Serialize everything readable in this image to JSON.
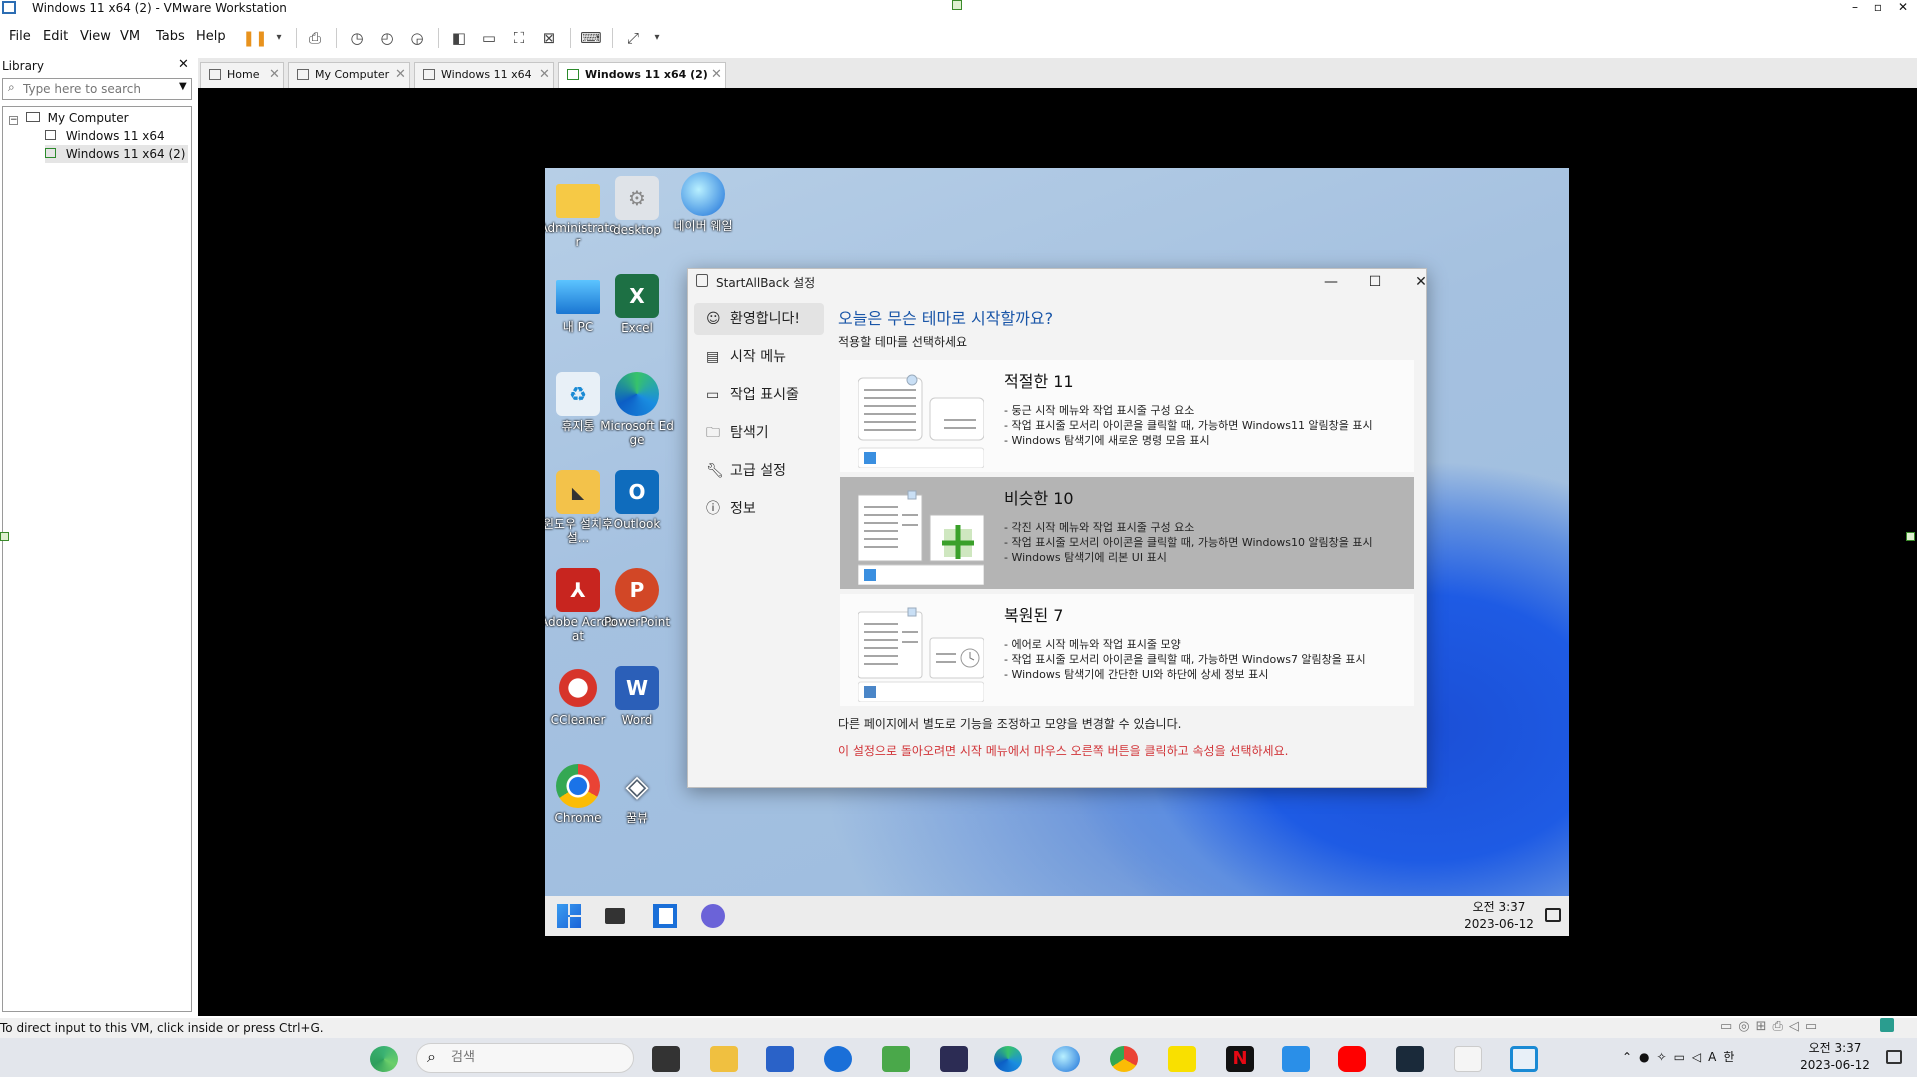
{
  "window": {
    "title": "Windows 11 x64 (2) - VMware Workstation"
  },
  "menu": [
    "File",
    "Edit",
    "View",
    "VM",
    "Tabs",
    "Help"
  ],
  "library": {
    "header": "Library",
    "search_placeholder": "Type here to search",
    "tree": {
      "root": "My Computer",
      "children": [
        "Windows 11 x64",
        "Windows 11 x64 (2)"
      ]
    }
  },
  "tabs": [
    "Home",
    "My Computer",
    "Windows 11 x64",
    "Windows 11 x64 (2)"
  ],
  "desktop_icons": [
    "Administrator",
    "desktop",
    "네이버 웨일",
    "내 PC",
    "Excel",
    "휴지통",
    "Microsoft Edge",
    "윈도우 설치후 설...",
    "Outlook",
    "Adobe Acrobat",
    "PowerPoint",
    "CCleaner",
    "Word",
    "Chrome",
    "꿀뷰"
  ],
  "dialog": {
    "title": "StartAllBack 설정",
    "nav": [
      "환영합니다!",
      "시작 메뉴",
      "작업 표시줄",
      "탐색기",
      "고급 설정",
      "정보"
    ],
    "heading": "오늘은 무슨 테마로 시작할까요?",
    "subheading": "적용할 테마를 선택하세요",
    "themes": [
      {
        "name": "적절한 11",
        "lines": [
          "- 둥근 시작 메뉴와 작업 표시줄 구성 요소",
          "- 작업 표시줄 모서리 아이콘을 클릭할 때, 가능하면 Windows11 알림창을 표시",
          "- Windows 탐색기에 새로운 명령 모음 표시"
        ]
      },
      {
        "name": "비슷한 10",
        "lines": [
          "- 각진 시작 메뉴와 작업 표시줄 구성 요소",
          "- 작업 표시줄 모서리 아이콘을 클릭할 때, 가능하면 Windows10 알림창을 표시",
          "- Windows 탐색기에 리본 UI 표시"
        ]
      },
      {
        "name": "복원된 7",
        "lines": [
          "- 에어로 시작 메뉴와 작업 표시줄 모양",
          "- 작업 표시줄 모서리 아이콘을 클릭할 때, 가능하면 Windows7 알림창을 표시",
          "- Windows 탐색기에 간단한 UI와 하단에 상세 정보 표시"
        ]
      }
    ],
    "note": "다른 페이지에서 별도로 기능을 조정하고 모양을 변경할 수 있습니다.",
    "warning": "이 설정으로 돌아오려면 시작 메뉴에서 마우스 오른쪽 버튼을 클릭하고 속성을 선택하세요."
  },
  "guest_clock": {
    "time": "오전 3:37",
    "date": "2023-06-12"
  },
  "status_text": "To direct input to this VM, click inside or press Ctrl+G.",
  "host_taskbar": {
    "search_placeholder": "검색",
    "time": "오전 3:37",
    "date": "2023-06-12"
  },
  "colors": {
    "accent": "#1a56a8",
    "warning": "#d13438",
    "selected_theme": "#b4b4b4"
  }
}
